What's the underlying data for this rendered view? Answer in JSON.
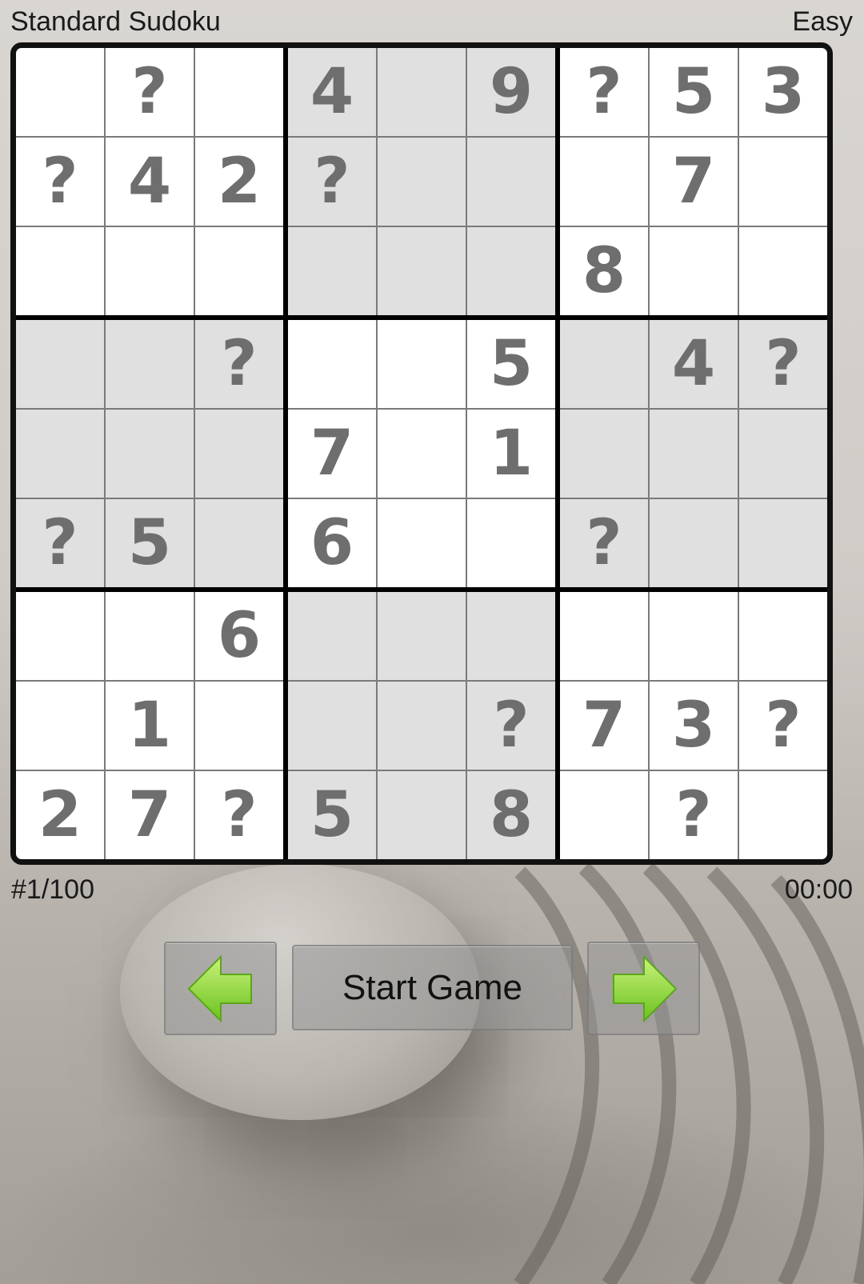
{
  "header": {
    "title": "Standard Sudoku",
    "difficulty": "Easy"
  },
  "board": {
    "rows": [
      [
        "",
        "?",
        "",
        "4",
        "",
        "9",
        "?",
        "5",
        "3"
      ],
      [
        "?",
        "4",
        "2",
        "?",
        "",
        "",
        "",
        "7",
        ""
      ],
      [
        "",
        "",
        "",
        "",
        "",
        "",
        "8",
        "",
        ""
      ],
      [
        "",
        "",
        "?",
        "",
        "",
        "5",
        "",
        "4",
        "?"
      ],
      [
        "",
        "",
        "",
        "7",
        "",
        "1",
        "",
        "",
        ""
      ],
      [
        "?",
        "5",
        "",
        "6",
        "",
        "",
        "?",
        "",
        ""
      ],
      [
        "",
        "",
        "6",
        "",
        "",
        "",
        "",
        "",
        ""
      ],
      [
        "",
        "1",
        "",
        "",
        "",
        "?",
        "7",
        "3",
        "?"
      ],
      [
        "2",
        "7",
        "?",
        "5",
        "",
        "8",
        "",
        "?",
        ""
      ]
    ],
    "shaded_boxes": [
      1,
      3,
      5,
      7
    ]
  },
  "footer": {
    "puzzle_number": "#1/100",
    "timer": "00:00"
  },
  "controls": {
    "start_label": "Start Game",
    "prev_icon": "arrow-left-icon",
    "next_icon": "arrow-right-icon",
    "arrow_color": "#8fd63a"
  }
}
